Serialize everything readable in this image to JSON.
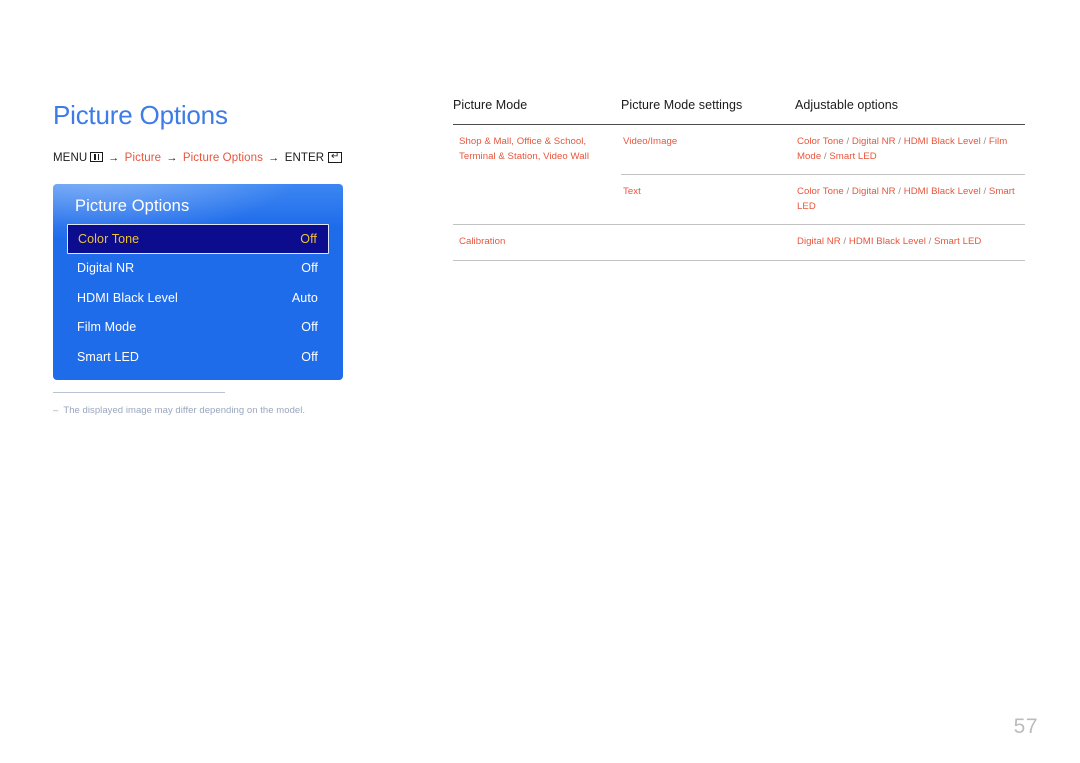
{
  "page": {
    "title": "Picture Options",
    "number": "57"
  },
  "breadcrumb": {
    "menu_label": "MENU",
    "menu_icon": "menu-icon",
    "arrow": "→",
    "step1": "Picture",
    "step2": "Picture Options",
    "enter_label": "ENTER",
    "enter_icon": "enter-icon",
    "enter_glyph": "↵"
  },
  "osd": {
    "title": "Picture Options",
    "rows": [
      {
        "label": "Color Tone",
        "value": "Off",
        "selected": true
      },
      {
        "label": "Digital NR",
        "value": "Off",
        "selected": false
      },
      {
        "label": "HDMI Black Level",
        "value": "Auto",
        "selected": false
      },
      {
        "label": "Film Mode",
        "value": "Off",
        "selected": false
      },
      {
        "label": "Smart LED",
        "value": "Off",
        "selected": false
      }
    ]
  },
  "footnote": {
    "dash": "–",
    "text": "The displayed image may differ depending on the model."
  },
  "table": {
    "headers": {
      "col1": "Picture Mode",
      "col2": "Picture Mode settings",
      "col3": "Adjustable options"
    },
    "rows": [
      {
        "picture_mode": "Shop & Mall, Office & School, Terminal & Station, Video Wall",
        "settings": "Video/Image",
        "options": "Color Tone / Digital NR / HDMI Black Level / Film Mode / Smart LED"
      },
      {
        "picture_mode": "",
        "settings": "Text",
        "options": "Color Tone / Digital NR / HDMI Black Level / Smart LED"
      },
      {
        "picture_mode": "Calibration",
        "settings": "",
        "options": "Digital NR / HDMI Black Level / Smart LED"
      }
    ]
  },
  "colors": {
    "heading_blue": "#3d7ce8",
    "accent_orange": "#e8553c",
    "osd_blue": "#1f6ceb",
    "osd_selected_bg": "#0c0c8e",
    "osd_selected_text": "#efc03a",
    "footnote_gray": "#9aa6bd",
    "page_number_gray": "#bcbcbc"
  }
}
